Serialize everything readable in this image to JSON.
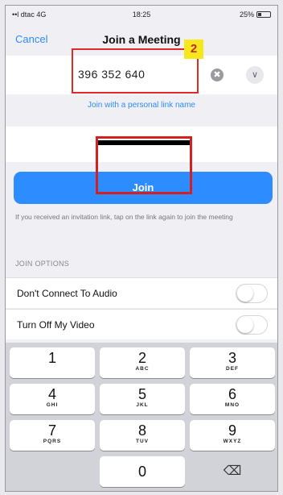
{
  "status_bar": {
    "carrier": "••l dtac  4G",
    "time": "18:25",
    "battery": "25%"
  },
  "nav": {
    "cancel_label": "Cancel",
    "title": "Join a Meeting"
  },
  "meeting_id": {
    "value": "396 352 640",
    "clear_icon": "✖",
    "dropdown_icon": "∨"
  },
  "annotation": {
    "step_number": "2"
  },
  "personal_link_label": "Join with a personal link name",
  "join_button_label": "Join",
  "hint_text": "If you received an invitation link, tap on the link again to join the meeting",
  "join_options": {
    "header": "JOIN OPTIONS",
    "items": [
      {
        "label": "Don't Connect To Audio",
        "on": false
      },
      {
        "label": "Turn Off My Video",
        "on": false
      }
    ]
  },
  "keypad": {
    "keys": [
      {
        "digit": "1",
        "letters": ""
      },
      {
        "digit": "2",
        "letters": "ABC"
      },
      {
        "digit": "3",
        "letters": "DEF"
      },
      {
        "digit": "4",
        "letters": "GHI"
      },
      {
        "digit": "5",
        "letters": "JKL"
      },
      {
        "digit": "6",
        "letters": "MNO"
      },
      {
        "digit": "7",
        "letters": "PQRS"
      },
      {
        "digit": "8",
        "letters": "TUV"
      },
      {
        "digit": "9",
        "letters": "WXYZ"
      },
      {
        "digit": "0",
        "letters": ""
      }
    ],
    "delete_icon": "⌫"
  },
  "colors": {
    "accent": "#2d8cff",
    "annotation": "#e02a2a",
    "badge": "#f8e71c"
  }
}
